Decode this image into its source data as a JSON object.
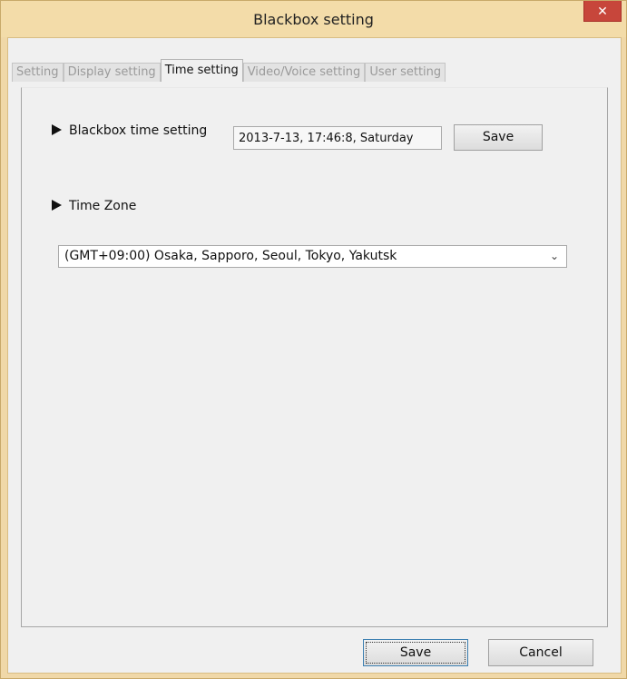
{
  "window": {
    "title": "Blackbox setting",
    "close_glyph": "✕"
  },
  "tabs": [
    {
      "label": "Setting",
      "active": false
    },
    {
      "label": "Display setting",
      "active": false
    },
    {
      "label": "Time setting",
      "active": true
    },
    {
      "label": "Video/Voice setting",
      "active": false
    },
    {
      "label": "User setting",
      "active": false
    }
  ],
  "time_setting": {
    "blackbox_time_label": "Blackbox time setting",
    "blackbox_time_value": "2013-7-13, 17:46:8, Saturday",
    "save_label": "Save",
    "time_zone_label": "Time Zone",
    "time_zone_selected": "(GMT+09:00) Osaka, Sapporo, Seoul, Tokyo, Yakutsk"
  },
  "footer": {
    "save_label": "Save",
    "cancel_label": "Cancel"
  },
  "colors": {
    "titlebar": "#f3dca9",
    "close": "#c7463b",
    "client": "#f0f0f0"
  },
  "icons": {
    "close": "close-icon",
    "arrow": "triangle-right-icon",
    "dropdown": "chevron-down-icon"
  }
}
